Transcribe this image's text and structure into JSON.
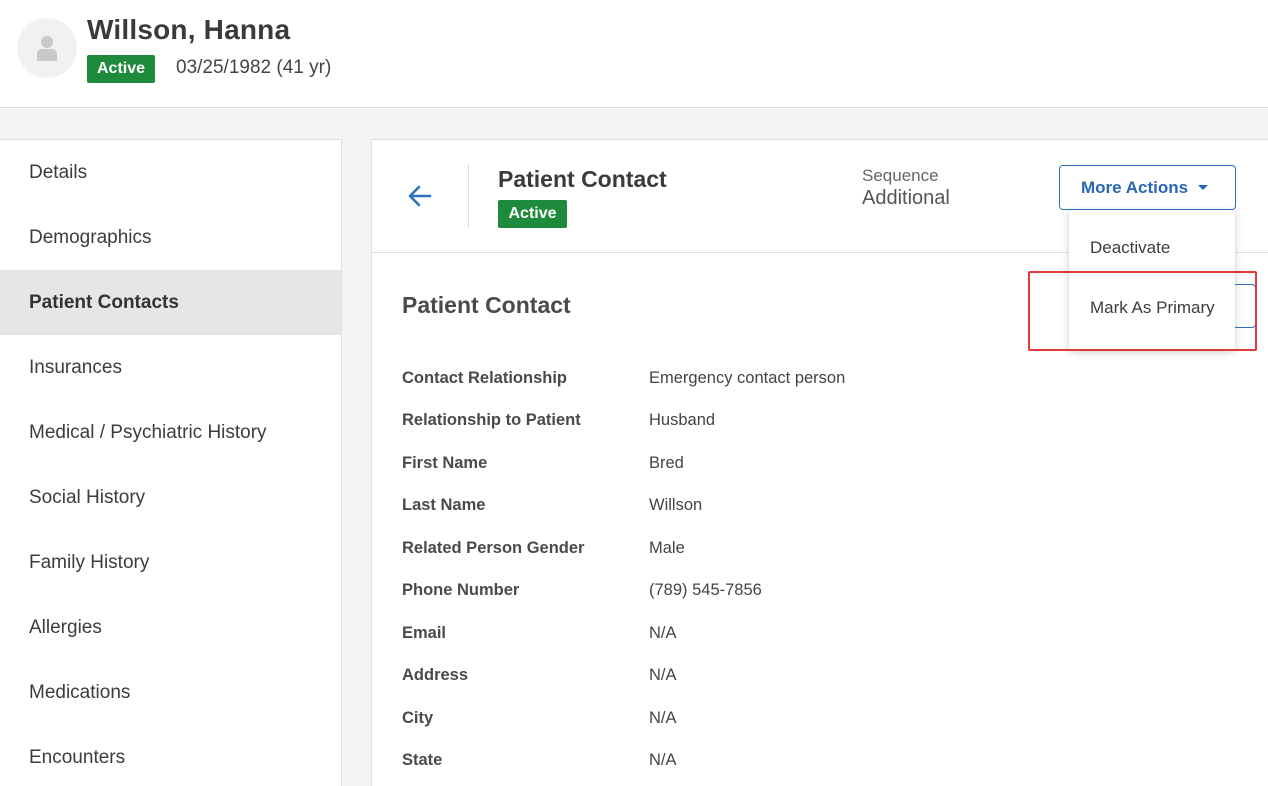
{
  "patient": {
    "name": "Willson, Hanna",
    "status": "Active",
    "dob": "03/25/1982 (41 yr)"
  },
  "sidebar": {
    "items": [
      {
        "label": "Details"
      },
      {
        "label": "Demographics"
      },
      {
        "label": "Patient Contacts"
      },
      {
        "label": "Insurances"
      },
      {
        "label": "Medical / Psychiatric History"
      },
      {
        "label": "Social History"
      },
      {
        "label": "Family History"
      },
      {
        "label": "Allergies"
      },
      {
        "label": "Medications"
      },
      {
        "label": "Encounters"
      }
    ]
  },
  "panel": {
    "title": "Patient Contact",
    "status": "Active",
    "sequence_label": "Sequence",
    "sequence_value": "Additional",
    "more_actions_label": "More Actions",
    "section_title": "Patient Contact",
    "fields": [
      {
        "label": "Contact Relationship",
        "value": "Emergency contact person"
      },
      {
        "label": "Relationship to Patient",
        "value": "Husband"
      },
      {
        "label": "First Name",
        "value": "Bred"
      },
      {
        "label": "Last Name",
        "value": "Willson"
      },
      {
        "label": "Related Person Gender",
        "value": "Male"
      },
      {
        "label": "Phone Number",
        "value": "(789) 545-7856"
      },
      {
        "label": "Email",
        "value": "N/A"
      },
      {
        "label": "Address",
        "value": "N/A"
      },
      {
        "label": "City",
        "value": "N/A"
      },
      {
        "label": "State",
        "value": "N/A"
      }
    ]
  },
  "dropdown": {
    "items": [
      {
        "label": "Deactivate"
      },
      {
        "label": "Mark As Primary"
      }
    ]
  },
  "colors": {
    "status_green": "#1e8a3c",
    "accent_blue": "#2866b8",
    "highlight_red": "#e03a3a",
    "active_nav_bg": "#e6e6e6"
  },
  "icons": {
    "avatar": "user-silhouette-icon",
    "back": "arrow-left-icon",
    "caret": "caret-down-icon"
  }
}
